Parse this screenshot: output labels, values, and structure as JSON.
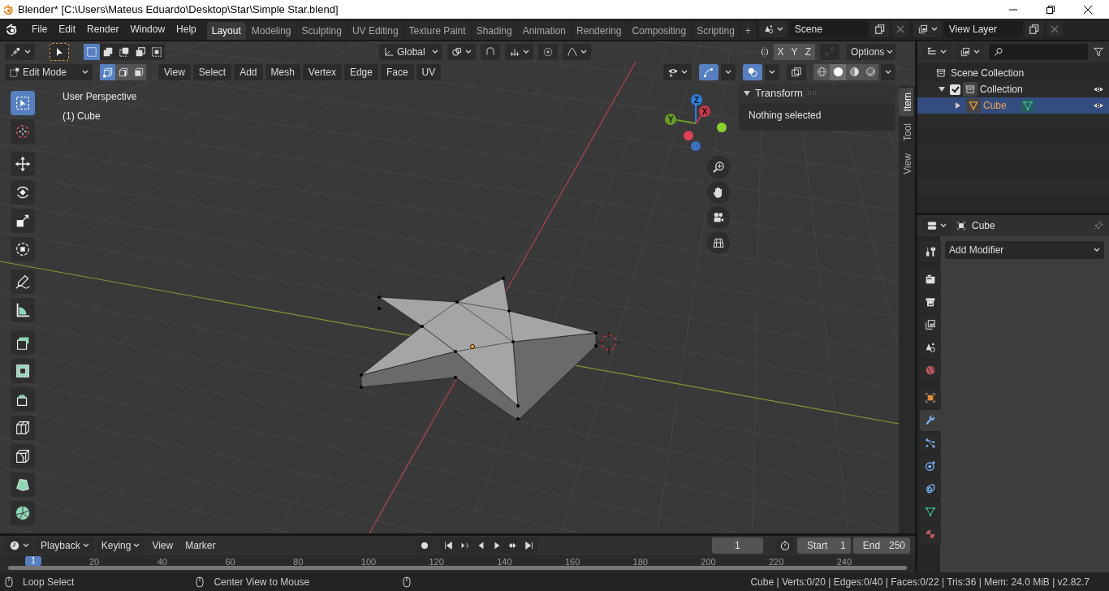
{
  "window": {
    "title": "Blender* [C:\\Users\\Mateus Eduardo\\Desktop\\Star\\Simple Star.blend]"
  },
  "menu": [
    "File",
    "Edit",
    "Render",
    "Window",
    "Help"
  ],
  "workspace_tabs": [
    {
      "label": "Layout",
      "selected": true
    },
    {
      "label": "Modeling",
      "selected": false
    },
    {
      "label": "Sculpting",
      "selected": false
    },
    {
      "label": "UV Editing",
      "selected": false
    },
    {
      "label": "Texture Paint",
      "selected": false
    },
    {
      "label": "Shading",
      "selected": false
    },
    {
      "label": "Animation",
      "selected": false
    },
    {
      "label": "Rendering",
      "selected": false
    },
    {
      "label": "Compositing",
      "selected": false
    },
    {
      "label": "Scripting",
      "selected": false
    }
  ],
  "add_workspace": "+",
  "scene": {
    "value": "Scene"
  },
  "view_layer": {
    "value": "View Layer"
  },
  "tool_header": {
    "select_modes": [
      {
        "selected": true
      },
      {
        "selected": false
      },
      {
        "selected": false
      },
      {
        "selected": false
      },
      {
        "selected": false
      }
    ],
    "orientation": "Global",
    "axes": [
      {
        "label": "X",
        "on": false
      },
      {
        "label": "Y",
        "on": false
      },
      {
        "label": "Z",
        "on": false
      }
    ],
    "options": "Options"
  },
  "viewport_header": {
    "mode": "Edit Mode",
    "element_modes": [
      {
        "kind": "vertex",
        "selected": true
      },
      {
        "kind": "edge",
        "selected": false
      },
      {
        "kind": "face",
        "selected": false
      }
    ],
    "menus": [
      "View",
      "Select",
      "Add",
      "Mesh",
      "Vertex",
      "Edge",
      "Face",
      "UV"
    ],
    "gizmos_on": true,
    "overlays_on": true,
    "shading": [
      {
        "kind": "wireframe",
        "selected": false
      },
      {
        "kind": "solid",
        "selected": true
      },
      {
        "kind": "material",
        "selected": false
      },
      {
        "kind": "rendered",
        "selected": false
      }
    ]
  },
  "toolbar": {
    "groups": [
      {
        "tools": [
          {
            "kind": "select_box",
            "selected": true
          },
          {
            "kind": "cursor",
            "selected": false
          }
        ]
      },
      {
        "tools": [
          {
            "kind": "move",
            "selected": false
          },
          {
            "kind": "rotate",
            "selected": false
          },
          {
            "kind": "scale",
            "selected": false
          },
          {
            "kind": "transform",
            "selected": false
          }
        ]
      },
      {
        "tools": [
          {
            "kind": "annotate",
            "selected": false
          },
          {
            "kind": "measure",
            "selected": false
          }
        ]
      },
      {
        "tools": [
          {
            "kind": "extrude",
            "selected": false
          },
          {
            "kind": "inset",
            "selected": false
          },
          {
            "kind": "bevel",
            "selected": false
          },
          {
            "kind": "loop_cut",
            "selected": false
          },
          {
            "kind": "knife",
            "selected": false
          },
          {
            "kind": "poly_build",
            "selected": false
          },
          {
            "kind": "spin",
            "selected": false
          }
        ]
      }
    ]
  },
  "viewport": {
    "overlay_text": [
      "User Perspective",
      "(1) Cube"
    ],
    "gizmo_axes": [
      "Z",
      "X",
      "Y"
    ]
  },
  "sidebar": {
    "panel_title": "Transform",
    "expanded": true,
    "message": "Nothing selected",
    "tabs": [
      {
        "label": "Item",
        "selected": true
      },
      {
        "label": "Tool",
        "selected": false
      },
      {
        "label": "View",
        "selected": false
      }
    ]
  },
  "outliner": {
    "items": [
      {
        "label": "Scene Collection",
        "kind": "scene_collection",
        "children": [
          {
            "label": "Collection",
            "kind": "collection",
            "checked": true,
            "expanded": true,
            "selected": false,
            "children": [
              {
                "label": "Cube",
                "kind": "mesh_object",
                "expanded": false,
                "selected": true
              }
            ]
          }
        ]
      }
    ]
  },
  "properties": {
    "object_name": "Cube",
    "add_modifier": "Add Modifier",
    "tab_groups": [
      {
        "tabs": [
          {
            "kind": "tool",
            "selected": false
          }
        ]
      },
      {
        "tabs": [
          {
            "kind": "render",
            "selected": false
          },
          {
            "kind": "output",
            "selected": false
          },
          {
            "kind": "view_layer",
            "selected": false
          },
          {
            "kind": "scene",
            "selected": false
          },
          {
            "kind": "world",
            "selected": false
          }
        ]
      },
      {
        "tabs": [
          {
            "kind": "object",
            "selected": false
          },
          {
            "kind": "modifiers",
            "selected": true
          },
          {
            "kind": "particles",
            "selected": false
          },
          {
            "kind": "physics",
            "selected": false
          },
          {
            "kind": "constraints",
            "selected": false
          },
          {
            "kind": "data",
            "selected": false
          },
          {
            "kind": "material",
            "selected": false
          }
        ]
      }
    ]
  },
  "timeline": {
    "menus": [
      "Playback",
      "Keying",
      "View",
      "Marker"
    ],
    "current_frame": "1",
    "start_label": "Start",
    "start": "1",
    "end_label": "End",
    "end": "250",
    "ruler": [
      "20",
      "40",
      "60",
      "80",
      "100",
      "120",
      "140",
      "160",
      "180",
      "200",
      "220",
      "240"
    ],
    "playhead": "1"
  },
  "status_bar": {
    "hints": [
      "Loop Select",
      "Center View to Mouse"
    ],
    "stats": "Cube | Verts:0/20 | Edges:0/40 | Faces:0/22 | Tris:36 | Mem: 24.0 MiB | v2.82.7"
  }
}
